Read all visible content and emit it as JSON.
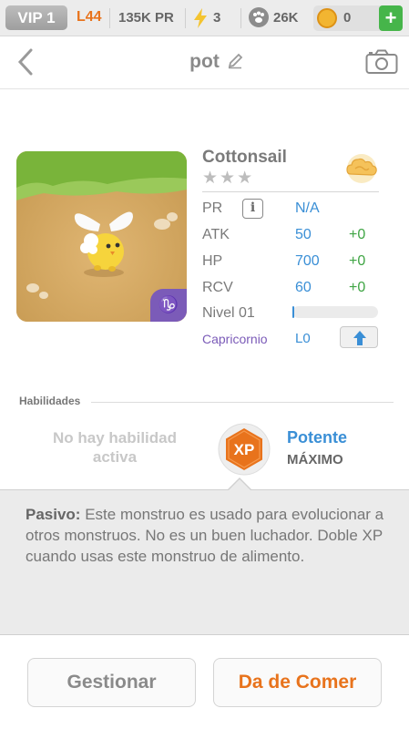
{
  "status_bar": {
    "vip": "VIP 1",
    "level": "L44",
    "power": "135K PR",
    "energy": "3",
    "food": "26K",
    "coins": "0",
    "add_label": "+"
  },
  "header": {
    "title": "pot"
  },
  "monster": {
    "name": "Cottonsail",
    "stars": "★★★",
    "zodiac_glyph": "♑"
  },
  "stats": {
    "pr_label": "PR",
    "info_label": "i",
    "pr_value": "N/A",
    "atk_label": "ATK",
    "atk_value": "50",
    "atk_bonus": "+0",
    "hp_label": "HP",
    "hp_value": "700",
    "hp_bonus": "+0",
    "rcv_label": "RCV",
    "rcv_value": "60",
    "rcv_bonus": "+0",
    "level_label": "Nivel 01",
    "xp_progress": 0.02,
    "zodiac_label": "Capricornio",
    "zodiac_level": "L0"
  },
  "abilities": {
    "section_label": "Habilidades",
    "no_active": "No hay habilidad activa",
    "badge": "XP",
    "passive_name": "Potente",
    "passive_level": "MÁXIMO"
  },
  "passive": {
    "label": "Pasivo:",
    "text": " Este monstruo es usado para evolucionar a otros monstruos. No es un buen luchador. Doble XP cuando usas este monstruo de alimento."
  },
  "buttons": {
    "manage": "Gestionar",
    "feed": "Da de Comer"
  },
  "colors": {
    "accent_orange": "#e8731c",
    "value_blue": "#3a8fd6",
    "bonus_green": "#3fa544",
    "zodiac_purple": "#7b5bb8"
  }
}
